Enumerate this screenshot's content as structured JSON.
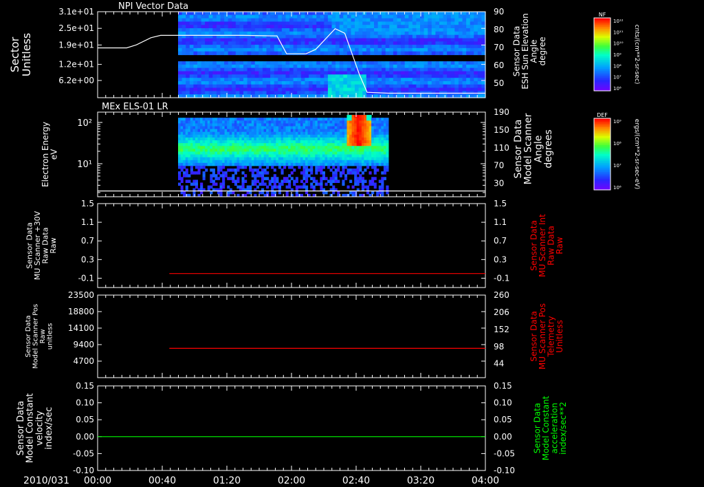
{
  "time_axis": {
    "date_label": "2010/031",
    "tick_labels": [
      "00:00",
      "00:40",
      "01:20",
      "02:00",
      "02:40",
      "03:20",
      "04:00"
    ],
    "range_hours": [
      0,
      4
    ]
  },
  "chart_data": [
    {
      "type": "heatmap",
      "title": "NPI Vector Data",
      "ylabel": "Sector\nUnitless",
      "ytick_labels": [
        "3.1e+01",
        "2.5e+01",
        "1.9e+01",
        "1.2e+01",
        "6.2e+00"
      ],
      "ytick_values": [
        31,
        25,
        19,
        12,
        6.2
      ],
      "ylim": [
        0,
        31
      ],
      "data_start_hour": 0.83,
      "data_end_hour": 4.0,
      "right_axis": {
        "label": "Sensor Data\nESH Sun Elevation\nAngle\ndegree",
        "ticks": [
          50,
          60,
          70,
          80,
          90
        ],
        "ylim": [
          42,
          90
        ],
        "color": "#ffffff"
      },
      "overlay_line": {
        "name": "ESH Sun Elevation Angle",
        "color": "#ffffff",
        "x": [
          0.0,
          0.3,
          0.4,
          0.55,
          0.65,
          1.0,
          1.5,
          1.85,
          1.95,
          2.15,
          2.25,
          2.45,
          2.55,
          2.7,
          2.78,
          3.0,
          3.5,
          4.0
        ],
        "y": [
          69.8,
          69.8,
          71.5,
          75.5,
          76.8,
          76.8,
          76.8,
          76.5,
          66.5,
          66.5,
          69,
          80.5,
          78,
          55,
          45,
          44.5,
          44.5,
          44.5
        ]
      },
      "colorbar": {
        "label": "NF",
        "tick_labels": [
          "10¹²",
          "10¹¹",
          "10¹⁰",
          "10⁹",
          "10⁸",
          "10⁷",
          "10⁶"
        ],
        "unit": "cnts/(cm**2-sr-sec)"
      }
    },
    {
      "type": "heatmap",
      "title": "MEx ELS-01 LR",
      "ylabel": "Electron Energy\neV",
      "ytick_labels": [
        "10²",
        "10¹"
      ],
      "ylim_log": [
        0.2,
        2.25
      ],
      "data_start_hour": 0.83,
      "data_end_hour": 3.0,
      "right_axis": {
        "label": "Sensor Data\nModel Scanner\nAngle\ndegrees",
        "ticks": [
          30,
          70,
          110,
          150,
          190
        ],
        "ylim": [
          0,
          190
        ],
        "color": "#ffffff"
      },
      "overlay_line": {
        "name": "Model Scanner Angle",
        "color": "#ffffff",
        "x": [
          0.0,
          4.0
        ],
        "y": [
          13,
          13
        ]
      },
      "colorbar": {
        "label": "DEF",
        "tick_labels": [
          "10⁹",
          "10⁸",
          "10⁷",
          "10⁶"
        ],
        "unit": "ergs/(cm**2-sr-sec-eV)"
      }
    },
    {
      "type": "line",
      "ylabel": "Sensor Data\nMU Scanner +30V\nRaw Data\nRaw",
      "ytick_values": [
        1.5,
        1.1,
        0.7,
        0.3,
        -0.1
      ],
      "ytick_labels": [
        "1.5",
        "1.1",
        "0.7",
        "0.3",
        "-0.1"
      ],
      "ylim": [
        -0.3,
        1.5
      ],
      "right_axis": {
        "label": "Sensor Data\nMU Scanner Int\nRaw Data\nRaw",
        "ticks": [
          -0.1,
          0.3,
          0.7,
          1.1,
          1.5
        ],
        "tick_labels": [
          "-0.1",
          "0.3",
          "0.7",
          "1.1",
          "1.5"
        ],
        "ylim": [
          -0.3,
          1.5
        ],
        "color": "#ff0000"
      },
      "series": [
        {
          "color": "#ff0000",
          "x": [
            0.74,
            4.0
          ],
          "y": [
            0.0,
            0.0
          ]
        }
      ]
    },
    {
      "type": "line",
      "ylabel": "Sensor Data\nModel Scanner Pos\nRaw\nunitless",
      "ytick_values": [
        23500,
        18800,
        14100,
        9400,
        4700
      ],
      "ytick_labels": [
        "23500",
        "18800",
        "14100",
        "9400",
        "4700"
      ],
      "ylim": [
        0,
        23500
      ],
      "right_axis": {
        "label": "Sensor Data\nMU Scanner Pos\nTelemetry\nUnitless",
        "ticks": [
          44,
          98,
          152,
          206,
          260
        ],
        "ylim": [
          0,
          260
        ],
        "color": "#ff0000"
      },
      "series": [
        {
          "color": "#ff0000",
          "x": [
            0.74,
            4.0
          ],
          "y": [
            8350,
            8350
          ]
        }
      ]
    },
    {
      "type": "line",
      "ylabel": "Sensor Data\nModel Constant\nvelocity\nindex/sec",
      "ytick_values": [
        0.15,
        0.1,
        0.05,
        0.0,
        -0.05,
        -0.1
      ],
      "ytick_labels": [
        "0.15",
        "0.10",
        "0.05",
        "0.00",
        "-0.05",
        "-0.10"
      ],
      "ylim": [
        -0.1,
        0.15
      ],
      "right_axis": {
        "label": "Sensor Data\nModel Constant\nacceleration\nindex/sec**2",
        "ticks": [
          0.15,
          0.1,
          0.05,
          0.0,
          -0.05,
          -0.1
        ],
        "tick_labels": [
          "0.15",
          "0.10",
          "0.05",
          "0.00",
          "-0.05",
          "-0.10"
        ],
        "ylim": [
          -0.1,
          0.15
        ],
        "color": "#00ff00"
      },
      "series": [
        {
          "color": "#00ff00",
          "x": [
            0.0,
            4.0
          ],
          "y": [
            0.0,
            0.0
          ]
        }
      ]
    }
  ]
}
